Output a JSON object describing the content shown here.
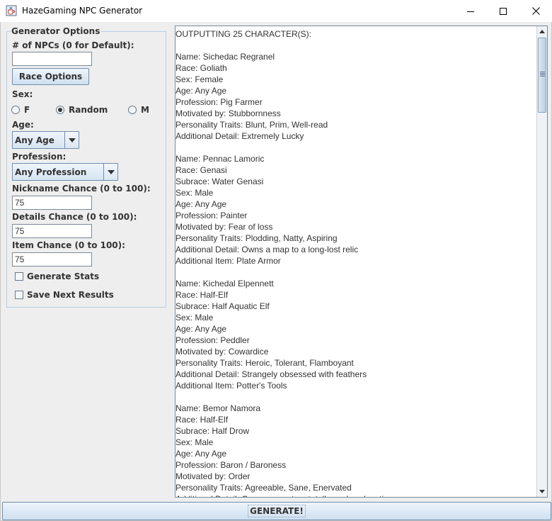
{
  "window": {
    "title": "HazeGaming NPC Generator",
    "icons": {
      "app": "coffee-cup-icon",
      "minimize": "minimize-icon",
      "maximize": "maximize-icon",
      "close": "close-icon"
    }
  },
  "options": {
    "legend": "Generator Options",
    "npc_count": {
      "label": "# of NPCs (0 for Default):",
      "value": ""
    },
    "race_button": "Race Options",
    "sex": {
      "label": "Sex:",
      "options": [
        "F",
        "Random",
        "M"
      ],
      "selected": "Random"
    },
    "age": {
      "label": "Age:",
      "selected": "Any Age"
    },
    "profession": {
      "label": "Profession:",
      "selected": "Any Profession"
    },
    "nickname_chance": {
      "label": "Nickname Chance (0 to 100):",
      "value": "75"
    },
    "details_chance": {
      "label": "Details Chance (0 to 100):",
      "value": "75"
    },
    "item_chance": {
      "label": "Item Chance (0 to 100):",
      "value": "75"
    },
    "generate_stats": {
      "label": "Generate Stats",
      "checked": false
    },
    "save_next": {
      "label": "Save Next Results",
      "checked": false
    }
  },
  "output": {
    "lines": [
      "OUTPUTTING 25 CHARACTER(S):",
      "",
      "Name: Sichedac Regranel",
      "Race: Goliath",
      "Sex: Female",
      "Age: Any Age",
      "Profession: Pig Farmer",
      "Motivated by: Stubbornness",
      "Personality Traits: Blunt, Prim, Well-read",
      "Additional Detail: Extremely Lucky",
      "",
      "Name: Pennac Lamoric",
      "Race: Genasi",
      "Subrace: Water Genasi",
      "Sex: Male",
      "Age: Any Age",
      "Profession: Painter",
      "Motivated by: Fear of loss",
      "Personality Traits: Plodding, Natty, Aspiring",
      "Additional Detail: Owns a map to a long-lost relic",
      "Additional Item: Plate Armor",
      "",
      "Name: Kichedal Elpennett",
      "Race: Half-Elf",
      "Subrace: Half Aquatic Elf",
      "Sex: Male",
      "Age: Any Age",
      "Profession: Peddler",
      "Motivated by: Cowardice",
      "Personality Traits: Heroic, Tolerant, Flamboyant",
      "Additional Detail: Strangely obsessed with feathers",
      "Additional Item: Potter's Tools",
      "",
      "Name: Bemor Namora",
      "Race: Half-Elf",
      "Subrace: Half Drow",
      "Sex: Male",
      "Age: Any Age",
      "Profession: Baron / Baroness",
      "Motivated by: Order",
      "Personality Traits: Agreeable, Sane, Enervated",
      "Additional Detail: Owns a map to a totally useless location"
    ]
  },
  "generate_button": "GENERATE!"
}
